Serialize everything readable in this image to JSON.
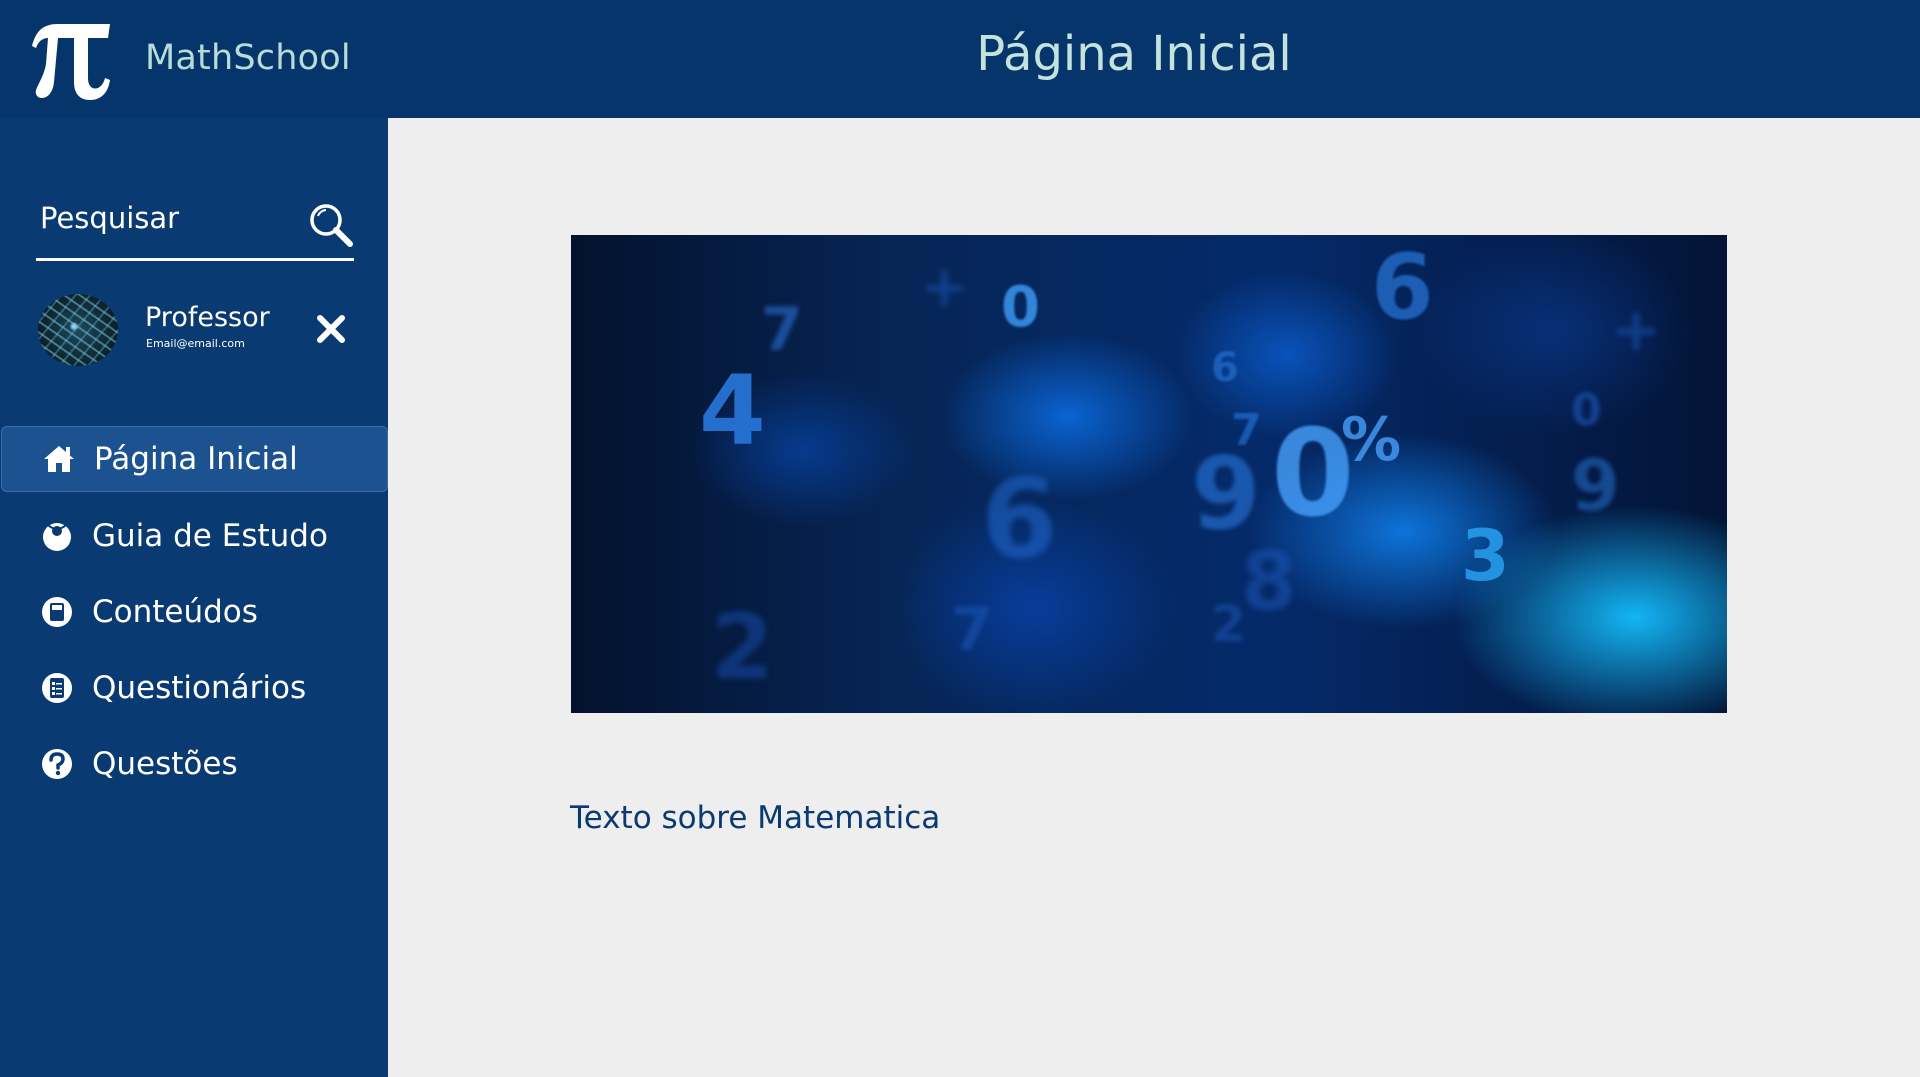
{
  "app": {
    "brand": "MathSchool",
    "logo_icon": "pi-icon"
  },
  "header": {
    "title": "Página Inicial"
  },
  "search": {
    "placeholder": "Pesquisar",
    "value": "",
    "icon": "search-icon"
  },
  "profile": {
    "name": "Professor",
    "email": "Email@email.com",
    "close_icon": "close-icon"
  },
  "sidebar": {
    "items": [
      {
        "label": "Página Inicial",
        "icon": "home-icon",
        "active": true
      },
      {
        "label": "Guia de Estudo",
        "icon": "study-guide-icon",
        "active": false
      },
      {
        "label": "Conteúdos",
        "icon": "contents-icon",
        "active": false
      },
      {
        "label": "Questionários",
        "icon": "quiz-icon",
        "active": false
      },
      {
        "label": "Questões",
        "icon": "question-icon",
        "active": false
      }
    ]
  },
  "main": {
    "body_text": "Texto sobre Matematica"
  },
  "colors": {
    "sidebar": "#0a3a72",
    "topbar": "#05356a",
    "active_item": "#1b528f",
    "content_bg": "#eeeeee",
    "title_text": "#c4e3dd",
    "body_text": "#0a3a72"
  }
}
